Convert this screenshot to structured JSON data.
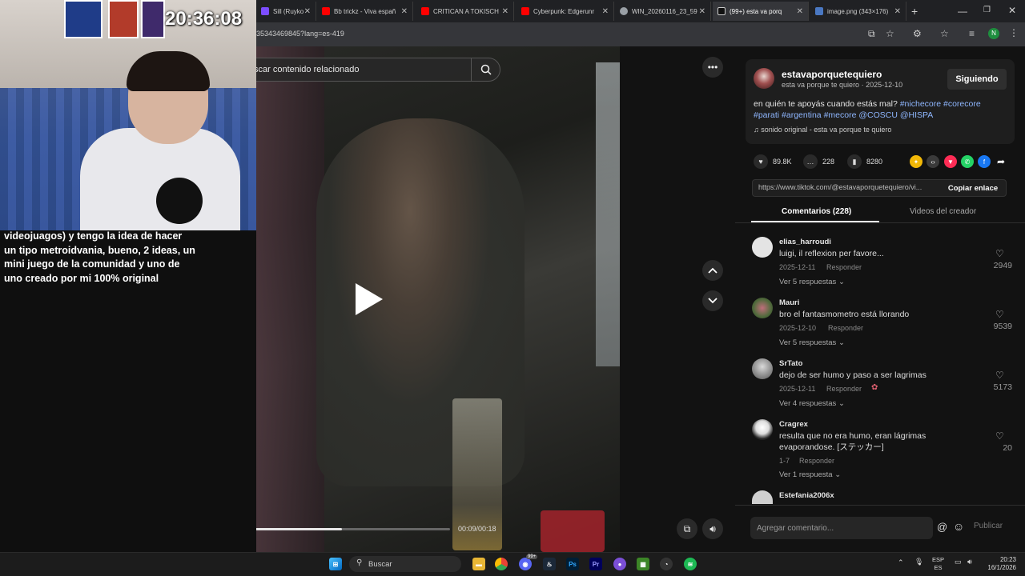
{
  "browser": {
    "tabs": [
      {
        "label": "Sill (Ruyko",
        "color": "#7c4dff"
      },
      {
        "label": "Bb trickz - Viva españ",
        "color": "#ff0000"
      },
      {
        "label": "CRITICAN A TOKISCH",
        "color": "#ff0000"
      },
      {
        "label": "Cyberpunk: Edgerunr",
        "color": "#ff0000"
      },
      {
        "label": "WIN_20260116_23_59",
        "color": "#9aa0a6"
      },
      {
        "label": "(99+) esta va porq",
        "color": "#111111"
      },
      {
        "label": "image.png (343×176)",
        "color": "#4a78c2"
      }
    ],
    "new_tab": "+",
    "url": "35343469845?lang=es-419",
    "profile_initial": "N"
  },
  "stream": {
    "clock": "20:36:08",
    "subtitle": "videojuagos) y tengo la idea de hacer un tipo metroidvania, bueno, 2 ideas, un mini juego de la comunidad y uno de uno creado por mi 100% original"
  },
  "video": {
    "search_placeholder": "scar contenido relacionado",
    "time": "00:09/00:18",
    "progress": 0.5
  },
  "post": {
    "author": "estavaporquetequiero",
    "author_sub": "esta va porque te quiero · 2025-12-10",
    "follow_label": "Siguiendo",
    "caption_text": "en quién te apoyás cuando estás mal?",
    "caption_tags_1": "#nichecore #corecore",
    "caption_tags_2": "#parati #argentina #mecore @COSCU @HISPA",
    "sound": "sonido original - esta va porque te quiero",
    "likes": "89.8K",
    "comments": "228",
    "saves": "8280",
    "link": "https://www.tiktok.com/@estavaporquetequiero/vi...",
    "copy_label": "Copiar enlace",
    "tab_comments": "Comentarios (228)",
    "tab_videos": "Videos del creador"
  },
  "comments": [
    {
      "user": "elias_harroudi",
      "text": "luigi, il reflexion per favore...",
      "date": "2025-12-11",
      "reply": "Responder",
      "more": "Ver 5 respuestas",
      "likes": "2949"
    },
    {
      "user": "Mauri",
      "text": "bro el fantasmometro está llorando",
      "date": "2025-12-10",
      "reply": "Responder",
      "more": "Ver 5 respuestas",
      "likes": "9539"
    },
    {
      "user": "SrTato",
      "text": "dejo de ser humo y paso a ser lagrimas",
      "date": "2025-12-11",
      "reply": "Responder",
      "more": "Ver 4 respuestas",
      "likes": "5173"
    },
    {
      "user": "Cragrex",
      "text": "resulta que no era humo, eran lágrimas evaporandose. [ステッカー]",
      "date": "1-7",
      "reply": "Responder",
      "more": "Ver 1 respuesta",
      "likes": "20"
    },
    {
      "user": "Estefania2006x",
      "text": "",
      "date": "",
      "reply": "",
      "more": "",
      "likes": ""
    }
  ],
  "comment_input": {
    "placeholder": "Agregar comentario...",
    "publish": "Publicar"
  },
  "taskbar": {
    "search": "Buscar",
    "lang_1": "ESP",
    "lang_2": "ES",
    "time": "20:23",
    "date": "16/1/2026",
    "discord_badge": "99+"
  }
}
